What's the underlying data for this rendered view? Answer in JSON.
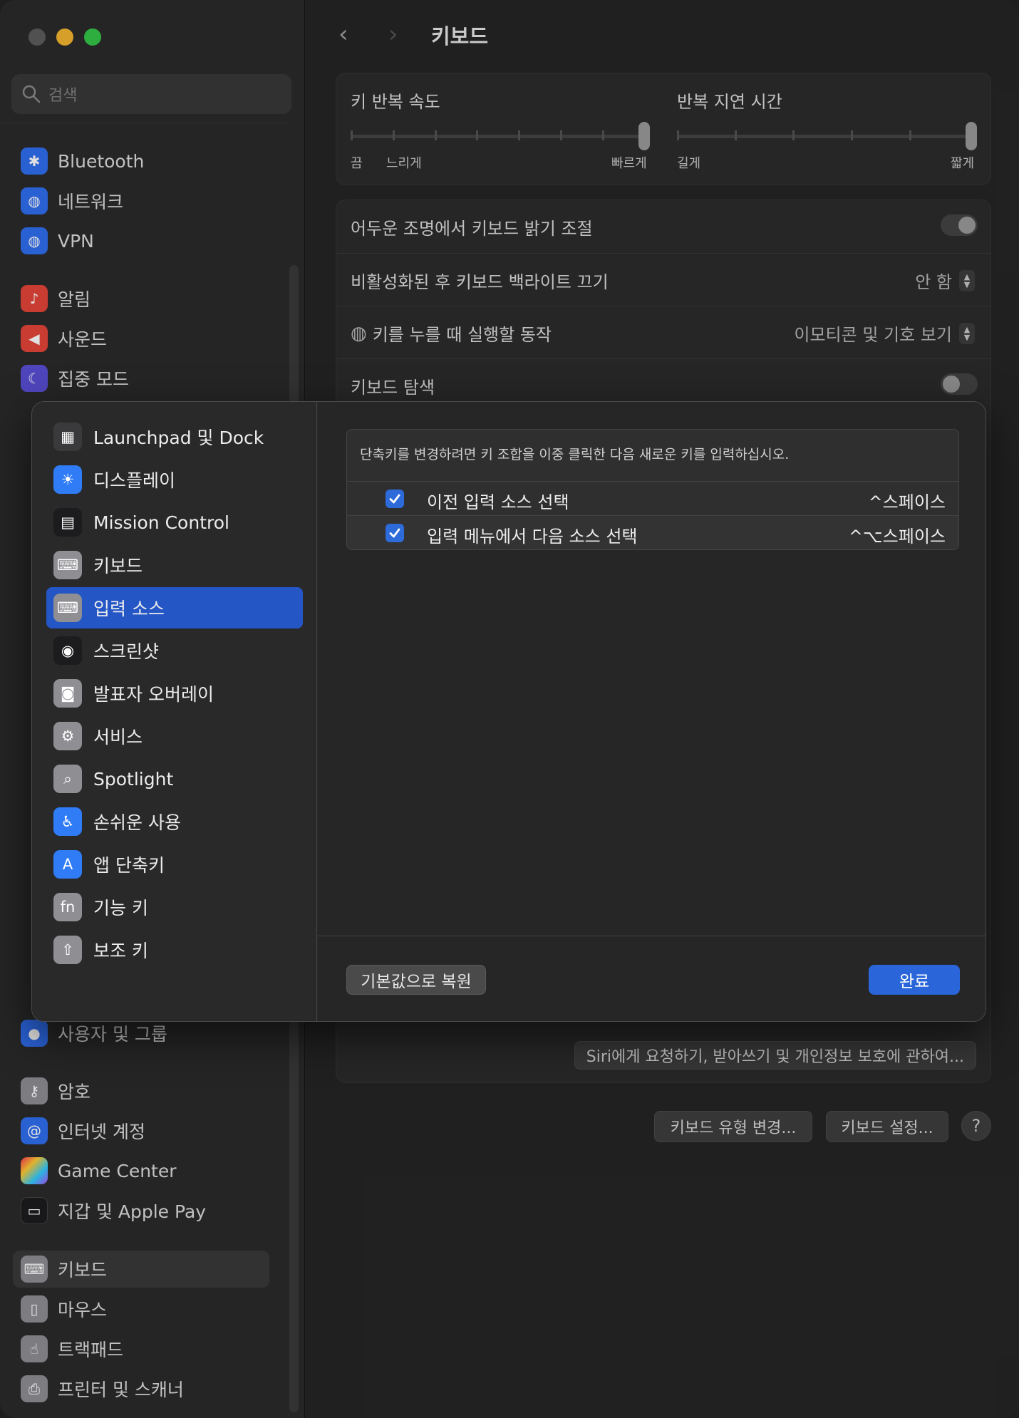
{
  "sidebar": {
    "search_placeholder": "검색",
    "items": [
      {
        "label": "Bluetooth",
        "icon": "bluetooth-icon"
      },
      {
        "label": "네트워크",
        "icon": "globe-icon"
      },
      {
        "label": "VPN",
        "icon": "vpn-globe-icon"
      },
      {
        "label": "알림",
        "icon": "bell-icon"
      },
      {
        "label": "사운드",
        "icon": "speaker-icon"
      },
      {
        "label": "집중 모드",
        "icon": "moon-icon"
      },
      {
        "label": "사용자 및 그룹",
        "icon": "users-icon"
      },
      {
        "label": "암호",
        "icon": "key-icon"
      },
      {
        "label": "인터넷 계정",
        "icon": "at-icon"
      },
      {
        "label": "Game Center",
        "icon": "game-center-icon"
      },
      {
        "label": "지갑 및 Apple Pay",
        "icon": "wallet-icon"
      },
      {
        "label": "키보드",
        "icon": "keyboard-icon"
      },
      {
        "label": "마우스",
        "icon": "mouse-icon"
      },
      {
        "label": "트랙패드",
        "icon": "trackpad-icon"
      },
      {
        "label": "프린터 및 스캐너",
        "icon": "printer-icon"
      }
    ]
  },
  "header": {
    "title": "키보드"
  },
  "repeat": {
    "key_repeat_label": "키 반복 속도",
    "key_repeat_min1": "끔",
    "key_repeat_min2": "느리게",
    "key_repeat_max": "빠르게",
    "key_repeat_level": 1.0,
    "delay_label": "반복 지연 시간",
    "delay_min": "길게",
    "delay_max": "짧게",
    "delay_level": 1.0
  },
  "settings": {
    "brightness_label": "어두운 조명에서 키보드 밝기 조절",
    "backlight_label": "비활성화된 후 키보드 백라이트 끄기",
    "backlight_value": "안 함",
    "globe_label": "키를 누를 때 실행할 동작",
    "globe_value": "이모티콘 및 기호 보기",
    "nav_label": "키보드 탐색"
  },
  "bottom": {
    "siri_button": "Siri에게 요청하기, 받아쓰기 및 개인정보 보호에 관하여...",
    "change_type_button": "키보드 유형 변경...",
    "keyboard_setup_button": "키보드 설정...",
    "help": "?"
  },
  "dialog": {
    "categories": [
      {
        "label": "Launchpad 및 Dock",
        "icon": "launchpad-icon",
        "color": "#3a3a3c"
      },
      {
        "label": "디스플레이",
        "icon": "display-brightness-icon",
        "color": "#2f7cf6"
      },
      {
        "label": "Mission Control",
        "icon": "mission-control-icon",
        "color": "#1c1c1e"
      },
      {
        "label": "키보드",
        "icon": "keyboard-icon",
        "color": "#8e8e93"
      },
      {
        "label": "입력 소스",
        "icon": "input-sources-icon",
        "color": "#8e8e93"
      },
      {
        "label": "스크린샷",
        "icon": "screenshot-icon",
        "color": "#1c1c1e"
      },
      {
        "label": "발표자 오버레이",
        "icon": "presenter-overlay-icon",
        "color": "#8e8e93"
      },
      {
        "label": "서비스",
        "icon": "gears-icon",
        "color": "#8e8e93"
      },
      {
        "label": "Spotlight",
        "icon": "spotlight-icon",
        "color": "#8e8e93"
      },
      {
        "label": "손쉬운 사용",
        "icon": "accessibility-icon",
        "color": "#2f7cf6"
      },
      {
        "label": "앱 단축키",
        "icon": "app-store-icon",
        "color": "#2f7cf6"
      },
      {
        "label": "기능 키",
        "icon": "fn-key-icon",
        "color": "#8e8e93"
      },
      {
        "label": "보조 키",
        "icon": "modifier-key-icon",
        "color": "#8e8e93"
      }
    ],
    "hint": "단축키를 변경하려면 키 조합을 이중 클릭한 다음 새로운 키를 입력하십시오.",
    "shortcuts": [
      {
        "label": "이전 입력 소스 선택",
        "keys": "^스페이스",
        "checked": true
      },
      {
        "label": "입력 메뉴에서 다음 소스 선택",
        "keys": "^⌥스페이스",
        "checked": true
      }
    ],
    "restore_button": "기본값으로 복원",
    "done_button": "완료"
  },
  "colors": {
    "accent": "#2456c6",
    "done": "#2a66d9"
  }
}
